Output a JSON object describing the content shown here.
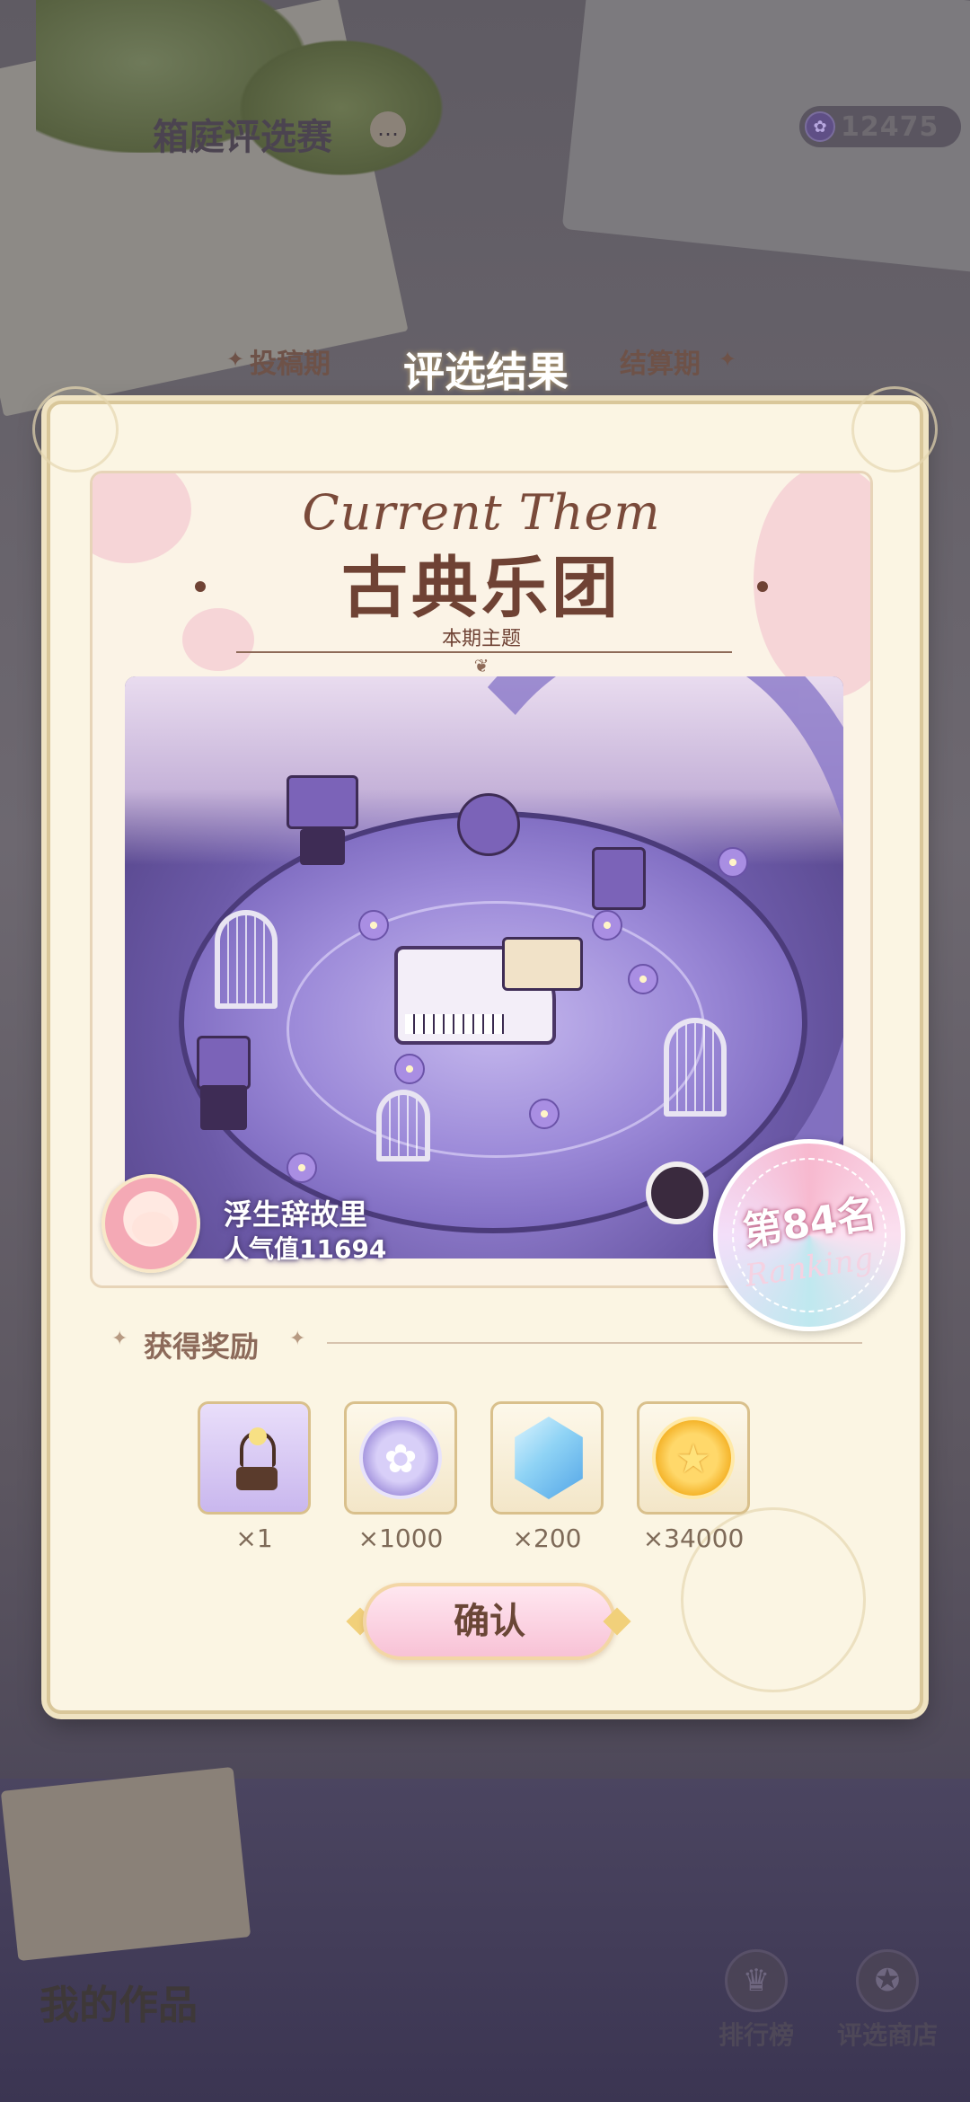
{
  "header": {
    "title": "箱庭评选赛",
    "currency_value": "12475"
  },
  "phases": {
    "left": "投稿期",
    "center": "评选结果",
    "right": "结算期"
  },
  "modal": {
    "theme_en": "Current Them",
    "theme_cn": "古典乐团",
    "theme_sub": "本期主题",
    "author_name": "浮生辞故里",
    "author_popularity": "人气值11694",
    "rank_text": "第84名",
    "rank_script": "Ranking",
    "reward_title": "获得奖励",
    "rewards": [
      {
        "icon": "gramophone-icon",
        "qty": "×1"
      },
      {
        "icon": "flower-coin-icon",
        "qty": "×1000"
      },
      {
        "icon": "crystal-icon",
        "qty": "×200"
      },
      {
        "icon": "star-coin-icon",
        "qty": "×34000"
      }
    ],
    "confirm_label": "确认"
  },
  "bottom": {
    "my_works": "我的作品",
    "leaderboard": "排行榜",
    "shop": "评选商店"
  },
  "colors": {
    "modal_bg": "#fbf5e3",
    "title_brown": "#6f4234",
    "confirm_pink": "#f8c2d6"
  }
}
